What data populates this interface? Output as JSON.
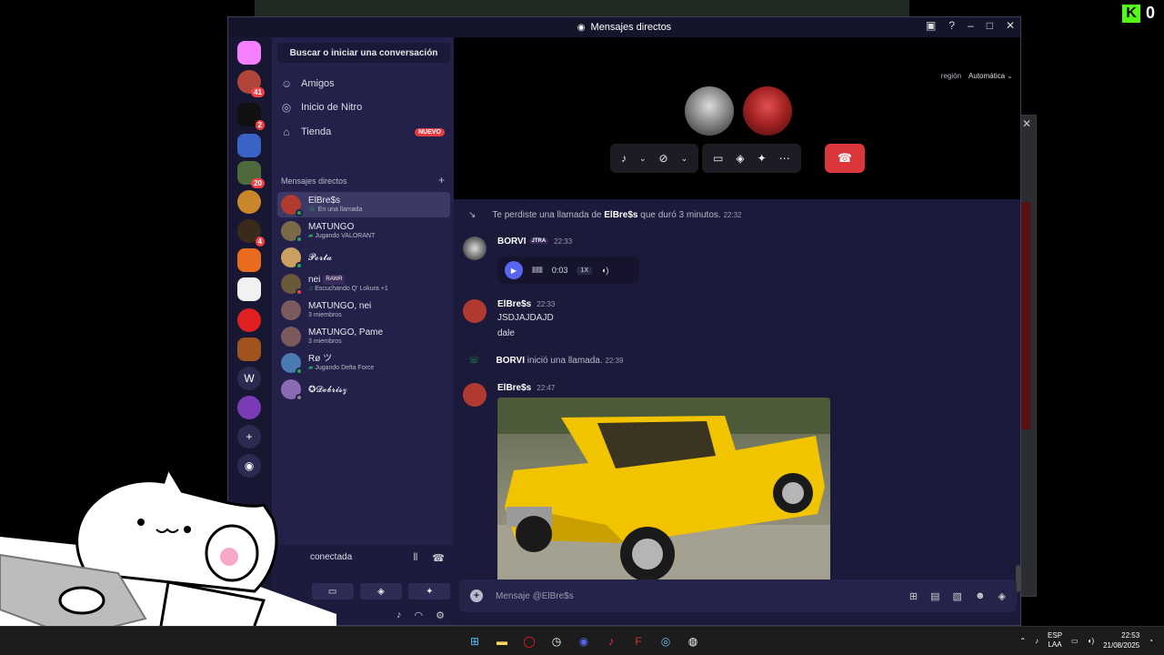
{
  "window": {
    "title": "Mensajes directos"
  },
  "kick": {
    "count": "0"
  },
  "servers": [
    {
      "name": "home",
      "badge": ""
    },
    {
      "name": "user-1",
      "badge": "41"
    },
    {
      "name": "server-1",
      "badge": "2"
    },
    {
      "name": "server-2",
      "badge": ""
    },
    {
      "name": "server-3",
      "badge": "20"
    },
    {
      "name": "server-4",
      "badge": ""
    },
    {
      "name": "server-5",
      "badge": "4"
    },
    {
      "name": "server-6",
      "badge": ""
    },
    {
      "name": "server-7",
      "badge": ""
    },
    {
      "name": "server-8",
      "badge": ""
    },
    {
      "name": "server-9",
      "badge": ""
    },
    {
      "name": "W",
      "badge": ""
    },
    {
      "name": "server-10",
      "badge": ""
    }
  ],
  "search": {
    "placeholder": "Buscar o iniciar una conversación"
  },
  "nav": {
    "friends": "Amigos",
    "nitro": "Inicio de Nitro",
    "shop": "Tienda",
    "shop_badge": "NUEVO"
  },
  "dm_header": {
    "label": "Mensajes directos",
    "add": "+"
  },
  "dms": [
    {
      "name": "ElBre$s",
      "sub": "En una llamada",
      "tag": "",
      "status": "#23a55a"
    },
    {
      "name": "MATUNGO",
      "sub": "Jugando VALORANT",
      "tag": "",
      "status": "#23a55a"
    },
    {
      "name": "𝓟𝓸𝓻𝓽𝓪",
      "sub": "",
      "tag": "",
      "status": "#23a55a"
    },
    {
      "name": "nei",
      "sub": "Escuchando Q' Lokura +1",
      "tag": "RAWR",
      "status": "#f23f43"
    },
    {
      "name": "MATUNGO, nei",
      "sub": "3 miembros",
      "tag": "",
      "status": ""
    },
    {
      "name": "MATUNGO, Pame",
      "sub": "3 miembros",
      "tag": "",
      "status": ""
    },
    {
      "name": "Rø ツ",
      "sub": "Jugando Delta Force",
      "tag": "",
      "status": "#23a55a"
    },
    {
      "name": "✪𝓓𝓮𝓫𝓻𝓲𝓼𝔃",
      "sub": "",
      "tag": "",
      "status": "#80848e"
    }
  ],
  "voice": {
    "status": "conectada"
  },
  "call": {
    "region_label": "región",
    "region_value": "Automática"
  },
  "messages": {
    "missed": {
      "text_before": "Te perdiste una llamada de ",
      "user": "ElBre$s",
      "text_after": " que duró 3 minutos.",
      "time": "22:32"
    },
    "borvi": {
      "author": "BORVI",
      "tag": "JTRA",
      "time": "22:33",
      "audio_time": "0:03",
      "speed": "1X"
    },
    "elbre1": {
      "author": "ElBre$s",
      "time": "22:33",
      "line1": "JSDJAJDAJD",
      "line2": "dale"
    },
    "call_started": {
      "user": "BORVI",
      "text": " inició una llamada.",
      "time": "22:39"
    },
    "elbre2": {
      "author": "ElBre$s",
      "time": "22:47"
    }
  },
  "composer": {
    "placeholder": "Mensaje @ElBre$s"
  },
  "taskbar": {
    "lang1": "ESP",
    "lang2": "LAA",
    "time": "22:53",
    "date": "21/08/2025"
  },
  "colors": {
    "accent": "#5865f2",
    "danger": "#da373c",
    "online": "#23a55a",
    "kick": "#53fc18"
  }
}
